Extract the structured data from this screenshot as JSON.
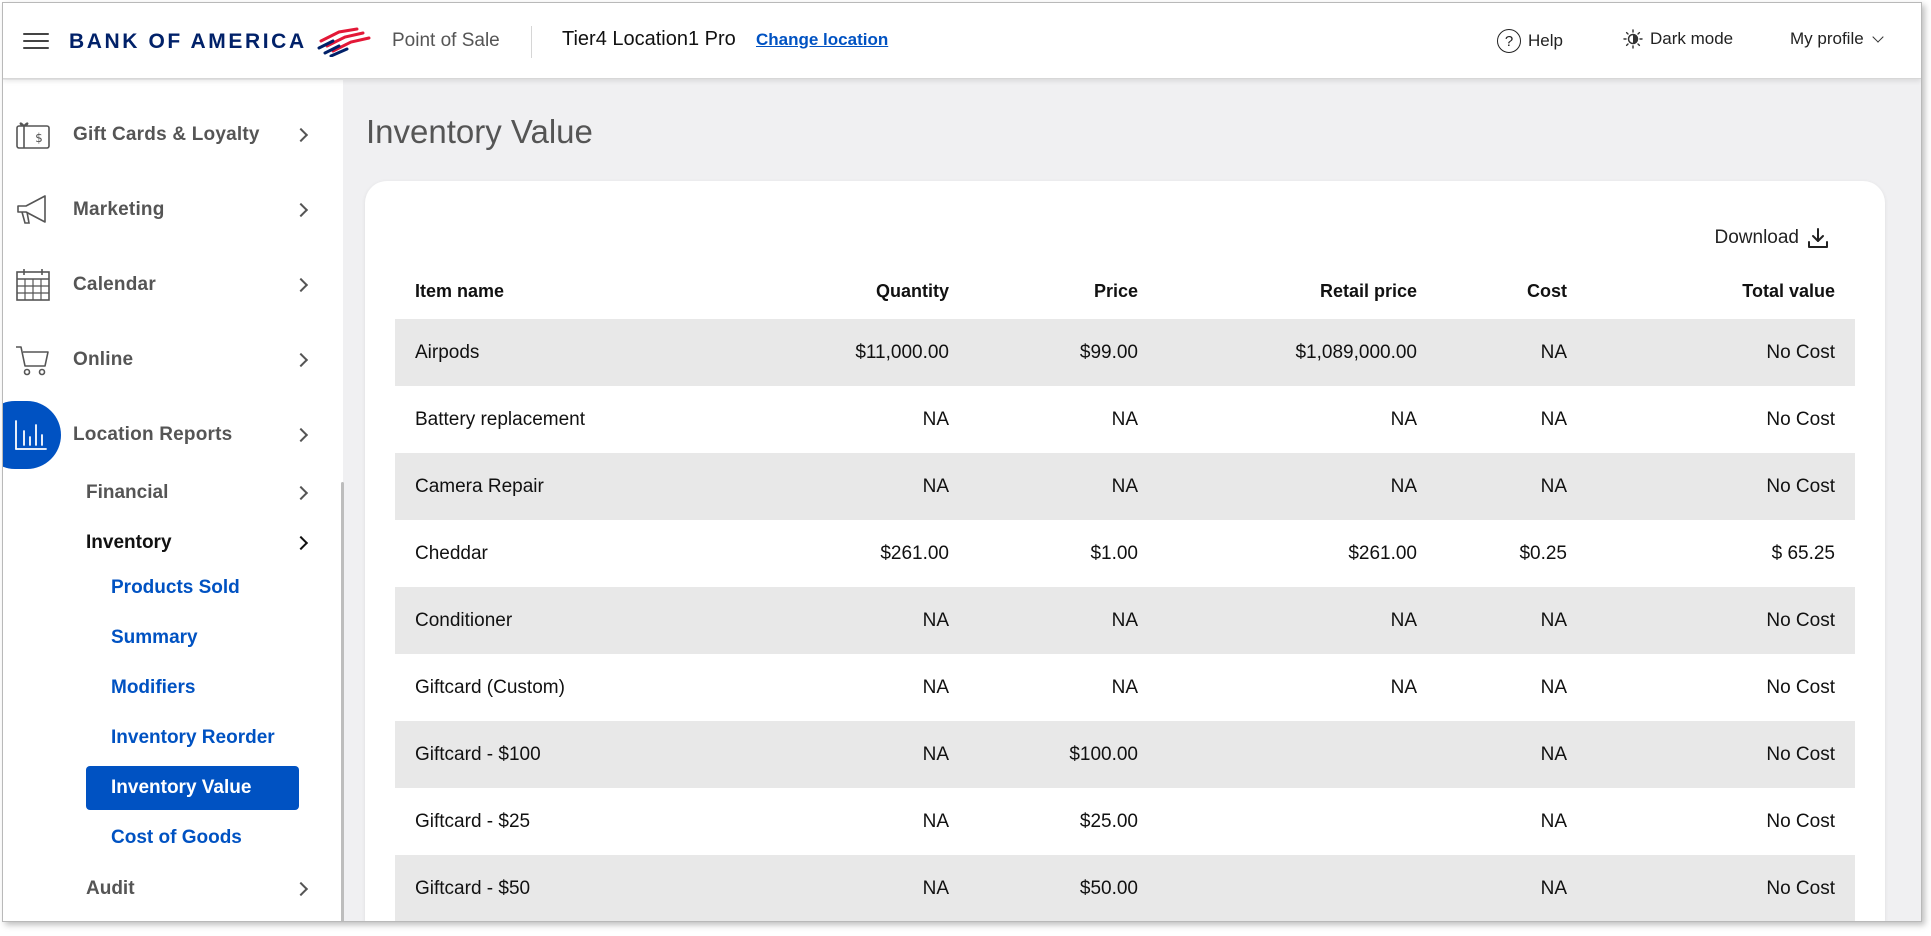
{
  "header": {
    "brand": "BANK OF AMERICA",
    "product": "Point of Sale",
    "location": "Tier4 Location1 Pro",
    "change_location": "Change location",
    "help": "Help",
    "dark_mode": "Dark mode",
    "my_profile": "My profile"
  },
  "sidebar": {
    "items": [
      {
        "label": "Gift Cards & Loyalty",
        "icon": "gift-card-icon"
      },
      {
        "label": "Marketing",
        "icon": "megaphone-icon"
      },
      {
        "label": "Calendar",
        "icon": "calendar-icon"
      },
      {
        "label": "Online",
        "icon": "cart-icon"
      },
      {
        "label": "Location Reports",
        "icon": "bar-chart-icon",
        "active": true
      }
    ],
    "subitems": [
      {
        "label": "Financial"
      },
      {
        "label": "Inventory",
        "expanded": true
      },
      {
        "label": "Audit"
      }
    ],
    "inventory_children": [
      {
        "label": "Products Sold"
      },
      {
        "label": "Summary"
      },
      {
        "label": "Modifiers"
      },
      {
        "label": "Inventory Reorder"
      },
      {
        "label": "Inventory Value",
        "selected": true
      },
      {
        "label": "Cost of Goods"
      }
    ]
  },
  "main": {
    "title": "Inventory Value",
    "download": "Download",
    "columns": [
      "Item name",
      "Quantity",
      "Price",
      "Retail price",
      "Cost",
      "Total value"
    ],
    "rows": [
      [
        "Airpods",
        "$11,000.00",
        "$99.00",
        "$1,089,000.00",
        "NA",
        "No Cost"
      ],
      [
        "Battery replacement",
        "NA",
        "NA",
        "NA",
        "NA",
        "No Cost"
      ],
      [
        "Camera Repair",
        "NA",
        "NA",
        "NA",
        "NA",
        "No Cost"
      ],
      [
        "Cheddar",
        "$261.00",
        "$1.00",
        "$261.00",
        "$0.25",
        "$ 65.25"
      ],
      [
        "Conditioner",
        "NA",
        "NA",
        "NA",
        "NA",
        "No Cost"
      ],
      [
        "Giftcard (Custom)",
        "NA",
        "NA",
        "NA",
        "NA",
        "No Cost"
      ],
      [
        "Giftcard - $100",
        "NA",
        "$100.00",
        "",
        "NA",
        "No Cost"
      ],
      [
        "Giftcard - $25",
        "NA",
        "$25.00",
        "",
        "NA",
        "No Cost"
      ],
      [
        "Giftcard - $50",
        "NA",
        "$50.00",
        "",
        "NA",
        "No Cost"
      ]
    ]
  },
  "colors": {
    "brand_navy": "#012169",
    "brand_red": "#e31837",
    "accent_blue": "#0052c2",
    "row_stripe": "#e8e8e8"
  }
}
